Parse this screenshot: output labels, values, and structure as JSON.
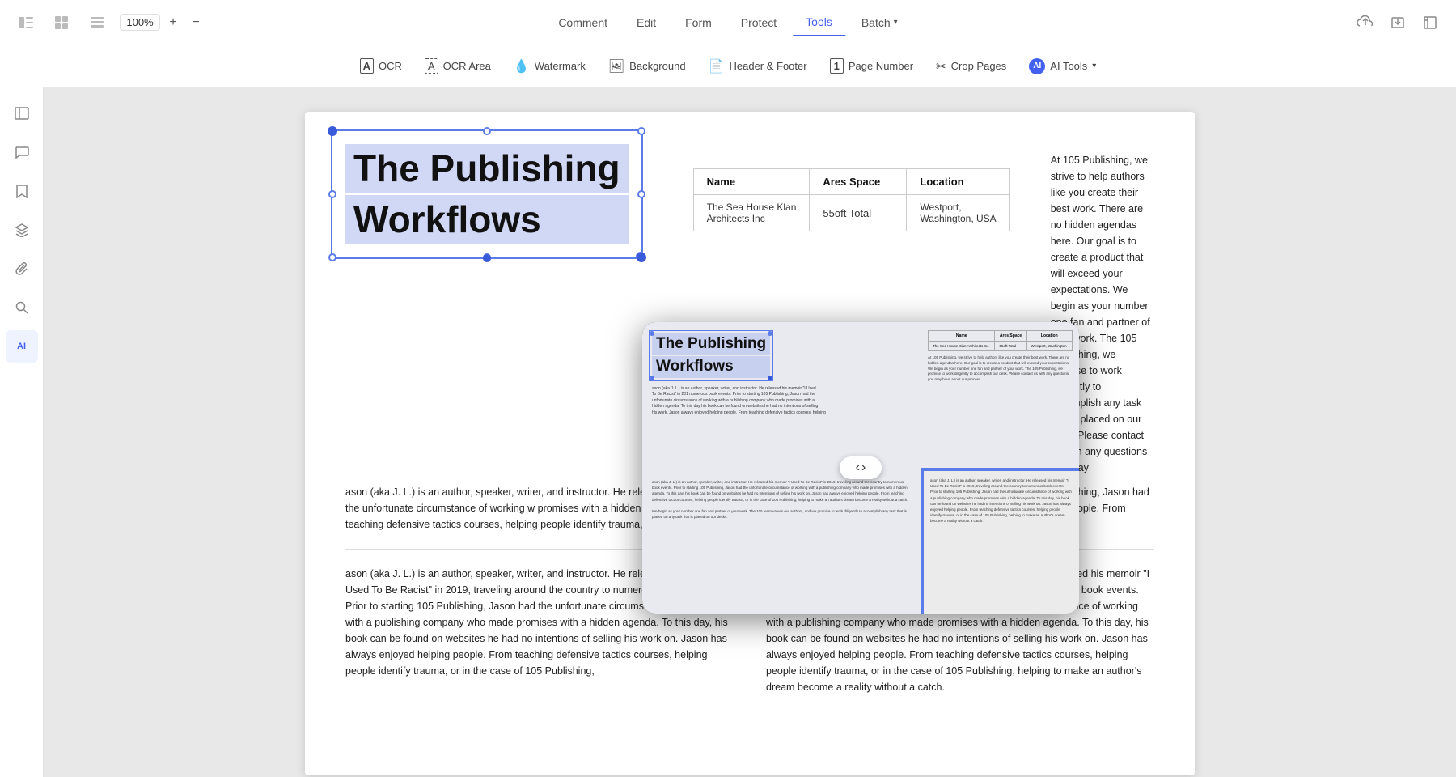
{
  "topbar": {
    "zoom_value": "100%",
    "nav_items": [
      {
        "label": "Comment",
        "active": false
      },
      {
        "label": "Edit",
        "active": false
      },
      {
        "label": "Form",
        "active": false
      },
      {
        "label": "Protect",
        "active": false
      },
      {
        "label": "Tools",
        "active": true
      },
      {
        "label": "Batch",
        "active": false,
        "has_arrow": true
      }
    ]
  },
  "secondary_toolbar": {
    "tools": [
      {
        "id": "ocr",
        "label": "OCR",
        "icon": "A"
      },
      {
        "id": "ocr-area",
        "label": "OCR Area",
        "icon": "⬜"
      },
      {
        "id": "watermark",
        "label": "Watermark",
        "icon": "💧"
      },
      {
        "id": "background",
        "label": "Background",
        "icon": "🖼"
      },
      {
        "id": "header-footer",
        "label": "Header & Footer",
        "icon": "📄"
      },
      {
        "id": "page-number",
        "label": "Page Number",
        "icon": "1"
      },
      {
        "id": "crop-pages",
        "label": "Crop Pages",
        "icon": "✂"
      },
      {
        "id": "ai-tools",
        "label": "AI Tools",
        "icon": "AI",
        "has_arrow": true
      }
    ]
  },
  "sidebar": {
    "items": [
      {
        "id": "panel",
        "icon": "▭",
        "active": false
      },
      {
        "id": "comment",
        "icon": "💬",
        "active": false
      },
      {
        "id": "bookmark",
        "icon": "🔖",
        "active": false
      },
      {
        "id": "layers",
        "icon": "⊞",
        "active": false
      },
      {
        "id": "attachment",
        "icon": "📎",
        "active": false
      },
      {
        "id": "search",
        "icon": "🔍",
        "active": false
      },
      {
        "id": "ai",
        "icon": "AI",
        "active": true
      }
    ]
  },
  "document": {
    "title_line1": "The Publishing",
    "title_line2": "Workflows",
    "table": {
      "headers": [
        "Name",
        "Ares Space",
        "Location"
      ],
      "row": [
        "The Sea House Klan Architects Inc",
        "55oft Total",
        "Westport, Washington, USA"
      ]
    },
    "body_text": "ason (aka J. L.) is an author, speaker, writer, and instructor. He released his memoir \"I Used To Be Racist\" in 201 numerous book events. Prior to starting 105 Publishing, Jason had the unfortunate circumstance of working w promises with a hidden agenda. To this day, his book can be found on websites he had no intentions of selling helping people. From teaching defensive tactics courses, helping people identify trauma, or in the case of 105 dream become a reality without a catch.",
    "body_text2_col1": "ason (aka J. L.) is an author, speaker, writer, and instructor. He released his memoir \"I Used To Be Racist\" in 2019, traveling around the country to numerous book events. Prior to starting 105 Publishing, Jason had the unfortunate circumstance of working with a publishing company who made promises with a hidden agenda. To this day, his book can be found on websites he had no intentions of selling his work on. Jason has always enjoyed helping people. From teaching defensive tactics courses, helping people identify trauma, or in the case of 105 Publishing,",
    "body_text2_col2": "At 105 Publishing, we strive to help authors like you create their best work. There are no hidden agendas here. Our goal is to create a product that will exceed your expectations. We begin as your number one fan and partner of your work. The 105 we promise to work number one fan and partner of your work. The 105 we promise to work diligently to accomplish our desk that is placed on contact us with any questions you may",
    "body_text_right": "At 105 Publishing, we strive to help authors like you create their best work. There are no hidden agendas here. Our goal is to create a product that will exceed your expectations. We begin as your number one fan and partner of your work. The 105 Publishing, we promise to work diligently to accomplish any task that is placed on our desk. Please contact us with any questions you may",
    "body_text_right2": "ason (aka J. L.) is an author, speaker, writer, and instructor. He released his memoir \"I Used To Be Racist\" in 2019, traveling around the country to numerous book events. Prior to starting 105 Publishing, Jason had the unfortunate circumstance of working with a publishing company who made promises with a hidden agenda. To this day, his book can be found on websites he had no intentions of selling his work on. Jason has always enjoyed helping people. From teaching defensive tactics courses, helping people identify trauma, or in the case of 105 Publishing, helping to make an author's dream become a reality without a catch."
  },
  "preview": {
    "nav_prev": "‹",
    "nav_next": "›"
  },
  "colors": {
    "accent": "#4361ee",
    "selection": "#5b7be8",
    "title_bg": "#d0d8f5",
    "preview_bg": "#1a1a1a"
  }
}
